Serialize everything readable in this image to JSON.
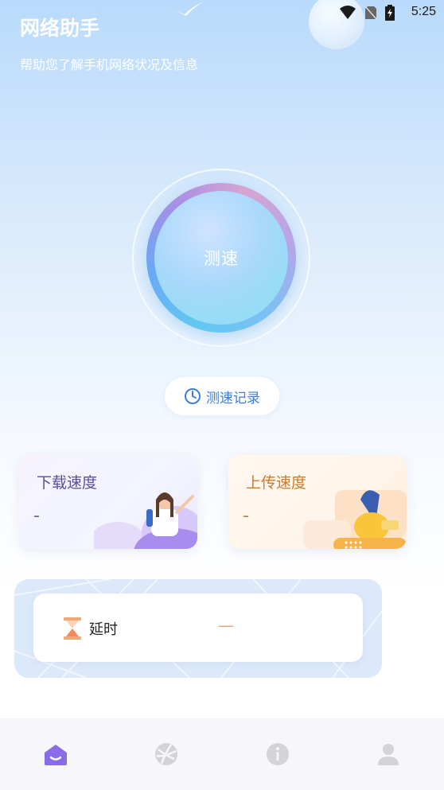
{
  "status": {
    "time": "5:25"
  },
  "header": {
    "title": "网络助手",
    "subtitle": "帮助您了解手机网络状况及信息"
  },
  "speedtest": {
    "button_label": "测速",
    "history_label": "测速记录"
  },
  "cards": {
    "download": {
      "title": "下载速度",
      "value": "-"
    },
    "upload": {
      "title": "上传速度",
      "value": "-"
    }
  },
  "latency": {
    "label": "延时",
    "value": "—"
  },
  "nav": {
    "items": [
      {
        "icon": "home-icon",
        "active": true
      },
      {
        "icon": "globe-icon",
        "active": false
      },
      {
        "icon": "info-icon",
        "active": false
      },
      {
        "icon": "user-icon",
        "active": false
      }
    ]
  },
  "colors": {
    "accent": "#7b5ee0",
    "history_text": "#3d7de0",
    "download_title": "#5a4aa0",
    "upload_title": "#d07a28"
  }
}
